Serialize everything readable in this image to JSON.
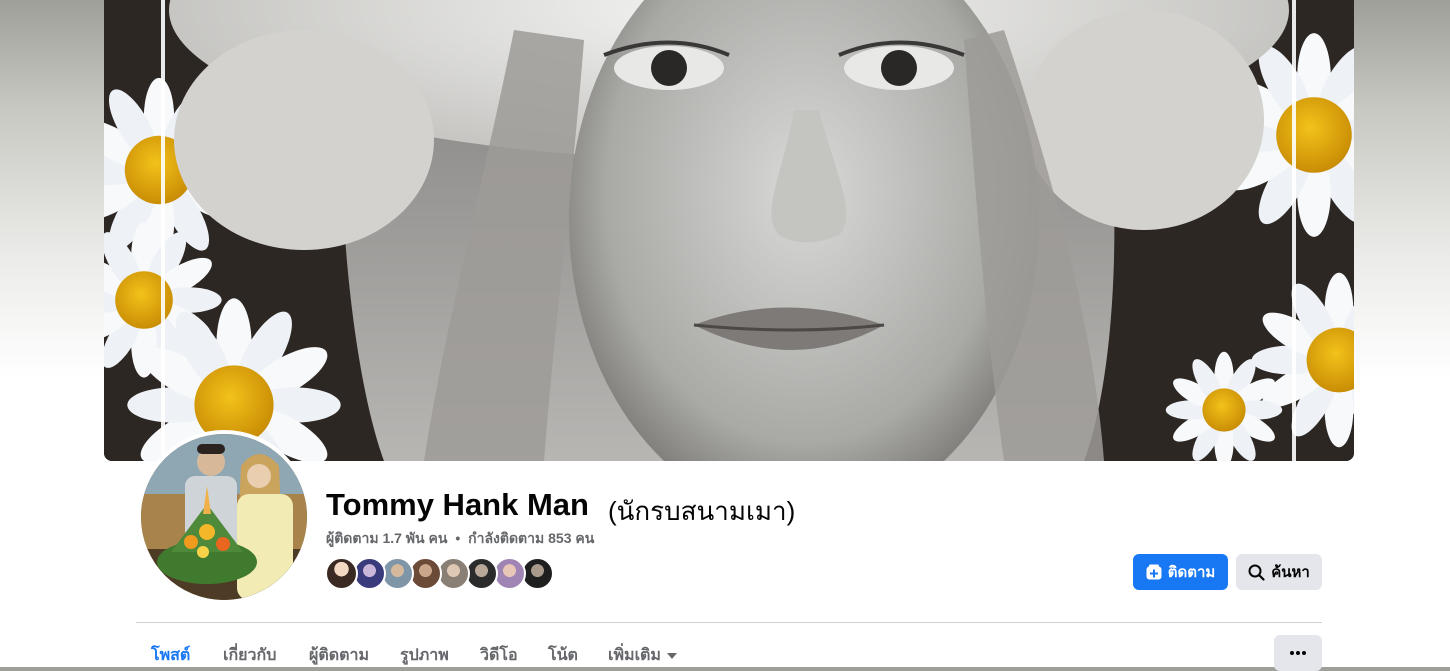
{
  "profile": {
    "name": "Tommy Hank Man",
    "alt_name": "(นักรบสนามเมา)",
    "followers_text": "ผู้ติดตาม 1.7 พัน คน",
    "separator": "•",
    "following_text": "กำลังติดตาม 853 คน"
  },
  "actions": {
    "follow_label": "ติดตาม",
    "search_label": "ค้นหา"
  },
  "tabs": {
    "posts": "โพสต์",
    "about": "เกี่ยวกับ",
    "followers": "ผู้ติดตาม",
    "photos": "รูปภาพ",
    "videos": "วิดีโอ",
    "notes": "โน้ต",
    "more": "เพิ่มเติม"
  },
  "icons": {
    "follow": "follow-plus-icon",
    "search": "search-icon",
    "more_caret": "caret-down-icon",
    "menu": "more-horizontal-icon"
  },
  "colors": {
    "accent": "#1877f2",
    "secondary_button": "#e4e6eb",
    "muted_text": "#65676b"
  }
}
